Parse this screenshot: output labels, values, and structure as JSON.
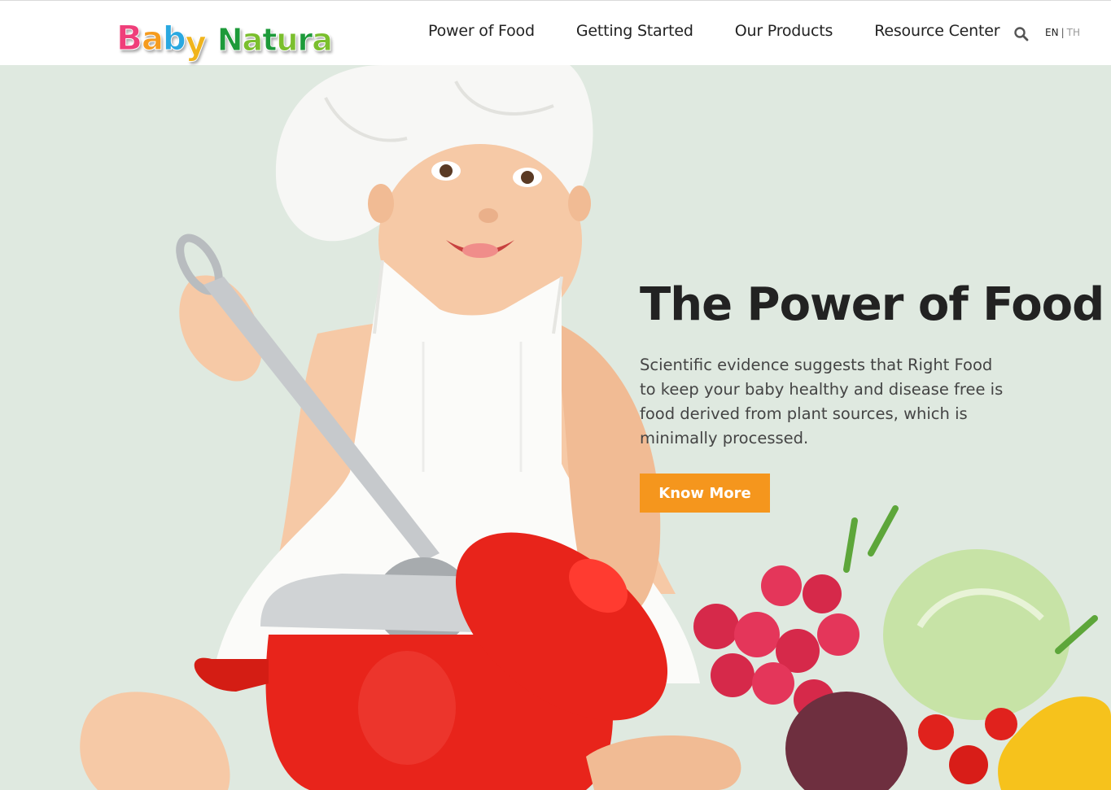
{
  "brand": {
    "logo_word1": [
      "B",
      "a",
      "b",
      "y"
    ],
    "logo_word2": [
      "N",
      "a",
      "t",
      "u",
      "r",
      "a"
    ],
    "colors": {
      "word1": [
        "#ef3f7a",
        "#f59b1e",
        "#2aa8e0",
        "#f0b41c"
      ],
      "word2": [
        "#1d9a3a",
        "#7bbf2e",
        "#1d9a3a",
        "#7bbf2e",
        "#1d9a3a",
        "#7bbf2e"
      ]
    }
  },
  "nav": {
    "items": [
      "Power of Food",
      "Getting Started",
      "Our Products",
      "Resource Center"
    ],
    "search_icon": "search-icon"
  },
  "language": {
    "active": "EN",
    "separator": "|",
    "other": "TH"
  },
  "hero": {
    "title": "The Power of Food",
    "text": "Scientific evidence suggests that Right Food to keep your baby healthy and disease free is food derived from plant sources, which is minimally processed.",
    "cta_label": "Know More",
    "background": "#dfe9e0",
    "accent": "#f5961d"
  }
}
